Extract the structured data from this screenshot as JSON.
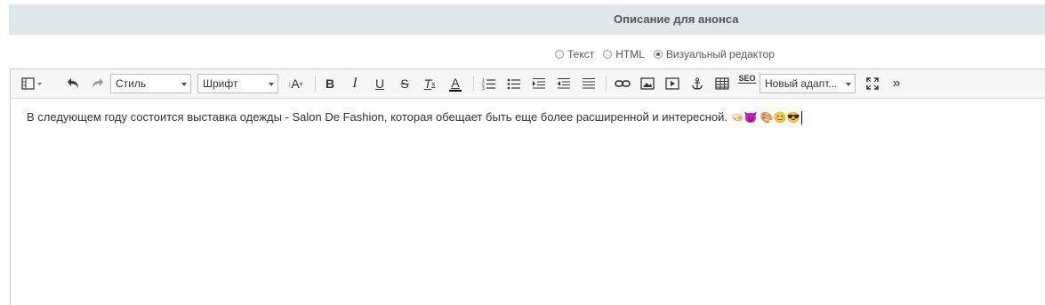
{
  "header": {
    "title": "Описание для анонса"
  },
  "modes": [
    {
      "label": "Текст",
      "checked": false
    },
    {
      "label": "HTML",
      "checked": false
    },
    {
      "label": "Визуальный редактор",
      "checked": true
    }
  ],
  "toolbar": {
    "style_combo": "Стиль",
    "font_combo": "Шрифт",
    "new_adapt_combo": "Новый адапт...",
    "font_size_label": "A",
    "bold": "B",
    "italic": "I",
    "underline": "U",
    "strike": "S",
    "clear_format": "T",
    "font_color": "A",
    "seo": "SEO",
    "more": "»",
    "icons": [
      "source-icon",
      "undo-icon",
      "redo-icon",
      "font-size-icon",
      "bold-icon",
      "italic-icon",
      "underline-icon",
      "strikethrough-icon",
      "remove-format-icon",
      "font-color-icon",
      "ordered-list-icon",
      "unordered-list-icon",
      "outdent-icon",
      "indent-icon",
      "justify-icon",
      "link-icon",
      "image-icon",
      "video-icon",
      "anchor-icon",
      "table-icon",
      "seo-icon",
      "fullscreen-icon",
      "more-icon"
    ]
  },
  "editor": {
    "text": "В следующем году состоится выставка одежды - Salon De Fashion, которая обещает быть еще более расширенной и интересной.",
    "emojis": "🤜🏻😈 🎨😊😎"
  }
}
